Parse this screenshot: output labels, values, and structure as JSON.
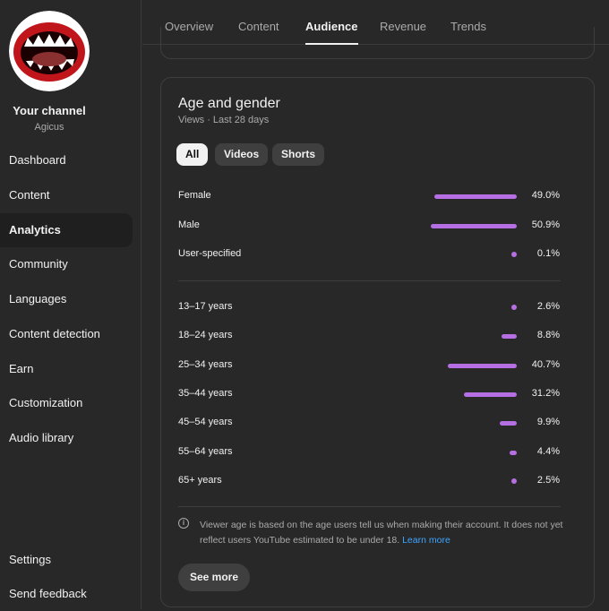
{
  "sidebar": {
    "channel_title": "Your channel",
    "channel_name": "Agicus",
    "items": [
      {
        "label": "Dashboard",
        "id": "dashboard"
      },
      {
        "label": "Content",
        "id": "content"
      },
      {
        "label": "Analytics",
        "id": "analytics"
      },
      {
        "label": "Community",
        "id": "community"
      },
      {
        "label": "Languages",
        "id": "languages"
      },
      {
        "label": "Content detection",
        "id": "content-detection"
      },
      {
        "label": "Earn",
        "id": "earn"
      },
      {
        "label": "Customization",
        "id": "customization"
      },
      {
        "label": "Audio library",
        "id": "audio-library"
      }
    ],
    "active_item": "Analytics",
    "settings_label": "Settings",
    "feedback_label": "Send feedback"
  },
  "tabs": [
    "Overview",
    "Content",
    "Audience",
    "Revenue",
    "Trends"
  ],
  "active_tab": "Audience",
  "card": {
    "title": "Age and gender",
    "subtitle": "Views · Last 28 days",
    "chips": [
      "All",
      "Videos",
      "Shorts"
    ],
    "active_chip": "All",
    "gender_rows": [
      {
        "label": "Female",
        "value": "49.0%",
        "share": 49.0
      },
      {
        "label": "Male",
        "value": "50.9%",
        "share": 50.9
      },
      {
        "label": "User-specified",
        "value": "0.1%",
        "share": 0.1
      }
    ],
    "age_rows": [
      {
        "label": "13–17 years",
        "value": "2.6%",
        "share": 2.6
      },
      {
        "label": "18–24 years",
        "value": "8.8%",
        "share": 8.8
      },
      {
        "label": "25–34 years",
        "value": "40.7%",
        "share": 40.7
      },
      {
        "label": "35–44 years",
        "value": "31.2%",
        "share": 31.2
      },
      {
        "label": "45–54 years",
        "value": "9.9%",
        "share": 9.9
      },
      {
        "label": "55–64 years",
        "value": "4.4%",
        "share": 4.4
      },
      {
        "label": "65+ years",
        "value": "2.5%",
        "share": 2.5
      }
    ],
    "note_text": "Viewer age is based on the age users tell us when making their account. It does not yet reflect users YouTube estimated to be under 18.",
    "note_link": "Learn more",
    "see_more_label": "See more"
  },
  "colors": {
    "accent_bar": "#b56fe3",
    "link": "#3ea6ff",
    "background": "#282828"
  }
}
